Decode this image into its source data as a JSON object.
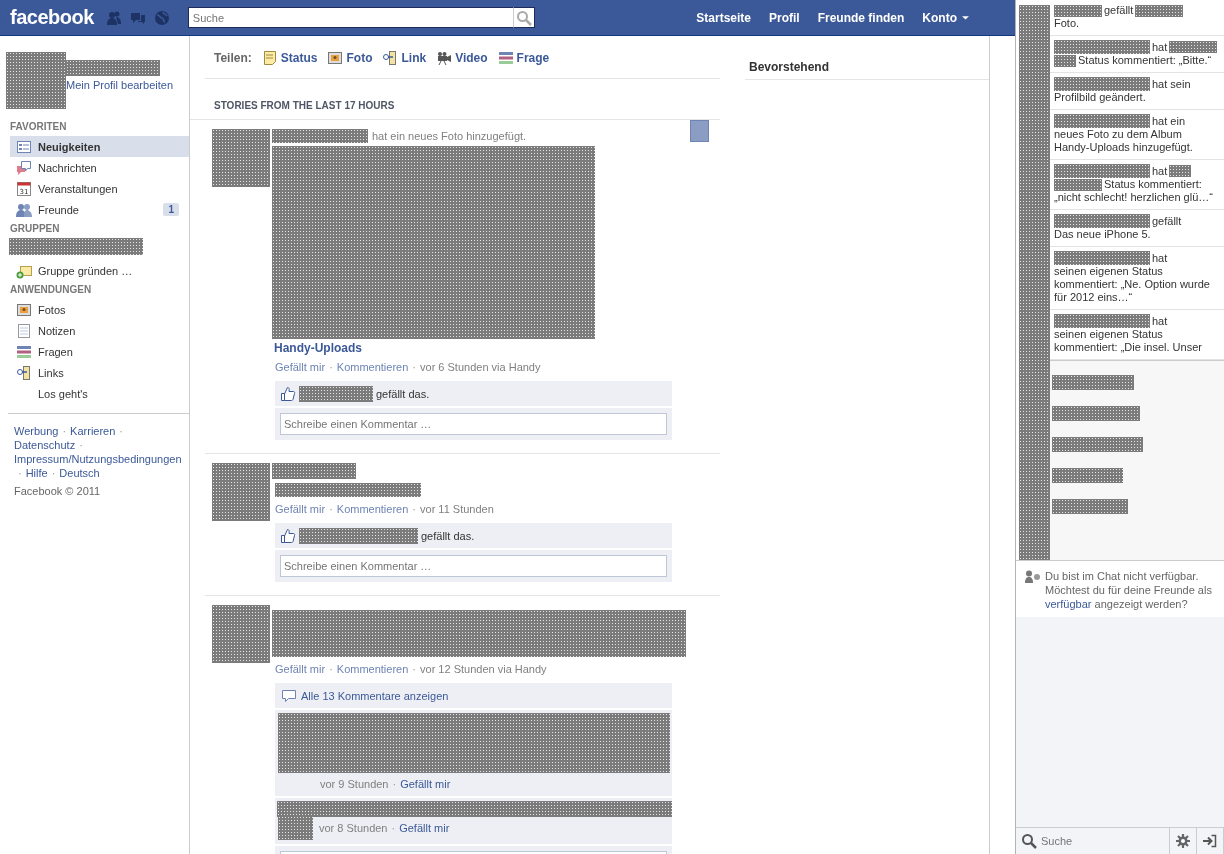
{
  "top_bar": {
    "logo": "facebook",
    "search": {
      "placeholder": "Suche"
    },
    "nav": [
      {
        "label": "Startseite",
        "menu": false
      },
      {
        "label": "Profil",
        "menu": false
      },
      {
        "label": "Freunde finden",
        "menu": false
      },
      {
        "label": "Konto",
        "menu": true
      }
    ]
  },
  "separator": "·",
  "sidebar": {
    "profile_link": "Mein Profil bearbeiten",
    "sections": [
      {
        "heading": "FAVORITEN",
        "items": [
          {
            "kind": "link",
            "label": "Neuigkeiten",
            "selected": true
          },
          {
            "kind": "link",
            "label": "Nachrichten",
            "selected": false
          },
          {
            "kind": "link",
            "icon_text": "31",
            "label": "Veranstaltungen",
            "selected": false
          },
          {
            "kind": "link",
            "label": "Freunde",
            "badge": "1",
            "selected": false
          }
        ]
      },
      {
        "heading": "GRUPPEN",
        "items": [
          {
            "kind": "redacted"
          },
          {
            "kind": "link",
            "label": "Gruppe gründen …",
            "selected": false
          }
        ]
      },
      {
        "heading": "ANWENDUNGEN",
        "items": [
          {
            "kind": "link",
            "label": "Fotos",
            "selected": false
          },
          {
            "kind": "link",
            "label": "Notizen",
            "selected": false
          },
          {
            "kind": "link",
            "label": "Fragen",
            "selected": false
          },
          {
            "kind": "link",
            "label": "Links",
            "selected": false
          },
          {
            "kind": "link",
            "label": "Los geht's",
            "selected": false
          }
        ]
      }
    ],
    "footer_links": [
      "Werbung",
      "Karrieren",
      "Datenschutz",
      "Impressum/Nutzungsbedingungen",
      "Hilfe",
      "Deutsch"
    ],
    "copyright": "Facebook © 2011"
  },
  "share_bar": {
    "label": "Teilen:",
    "options": [
      {
        "label": "Status"
      },
      {
        "label": "Foto"
      },
      {
        "label": "Link"
      },
      {
        "label": "Video"
      },
      {
        "label": "Frage"
      }
    ]
  },
  "feed": {
    "heading": "STORIES FROM THE LAST 17 HOURS",
    "posts": [
      {
        "kind": "photo",
        "caption": "hat ein neues Foto hinzugefügt.",
        "album": "Handy-Uploads",
        "options_button": true,
        "actions": [
          "Gefällt mir",
          "Kommentieren"
        ],
        "time": "vor 6 Stunden via Handy",
        "likes": "gefällt das.",
        "comment_field": true,
        "comment_placeholder": "Schreibe einen Kommentar …"
      },
      {
        "kind": "status",
        "options_button": false,
        "actions": [
          "Gefällt mir",
          "Kommentieren"
        ],
        "time": "vor 11 Stunden",
        "likes": "gefällt das.",
        "comment_field": true,
        "comment_placeholder": "Schreibe einen Kommentar …"
      },
      {
        "kind": "long_status",
        "options_button": false,
        "actions": [
          "Gefällt mir",
          "Kommentieren"
        ],
        "time": "vor 12 Stunden via Handy",
        "show_all": "Alle 13 Kommentare anzeigen",
        "comments": [
          {
            "kind": "block",
            "time": "vor 9 Stunden",
            "like": "Gefällt mir"
          },
          {
            "kind": "with_avatar",
            "time": "vor 8 Stunden",
            "like": "Gefällt mir"
          }
        ],
        "comment_field": true
      }
    ]
  },
  "upcoming": {
    "title": "Bevorstehend"
  },
  "ticker": [
    {
      "lines": [
        [
          {
            "kind": "redacted"
          },
          {
            "kind": "text",
            "text": "gefällt"
          },
          {
            "kind": "redacted"
          }
        ],
        [
          {
            "kind": "text",
            "text": "Foto."
          }
        ]
      ]
    },
    {
      "lines": [
        [
          {
            "kind": "redacted_long"
          },
          {
            "kind": "text",
            "text": "hat"
          },
          {
            "kind": "redacted"
          }
        ],
        [
          {
            "kind": "redacted_short"
          },
          {
            "kind": "text",
            "text": "Status kommentiert: „Bitte.“"
          }
        ]
      ]
    },
    {
      "lines": [
        [
          {
            "kind": "redacted_long"
          },
          {
            "kind": "text",
            "text": "hat sein"
          }
        ],
        [
          {
            "kind": "text",
            "text": "Profilbild geändert."
          }
        ]
      ]
    },
    {
      "lines": [
        [
          {
            "kind": "redacted_long"
          },
          {
            "kind": "text",
            "text": "hat ein"
          }
        ],
        [
          {
            "kind": "text",
            "text": "neues Foto zu dem Album"
          }
        ],
        [
          {
            "kind": "text",
            "text": "Handy-Uploads hinzugefügt."
          }
        ]
      ]
    },
    {
      "lines": [
        [
          {
            "kind": "redacted_long"
          },
          {
            "kind": "text",
            "text": "hat"
          },
          {
            "kind": "redacted_short"
          }
        ],
        [
          {
            "kind": "redacted"
          },
          {
            "kind": "text",
            "text": "Status kommentiert:"
          }
        ],
        [
          {
            "kind": "text",
            "text": "„nicht schlecht! herzlichen glü…“"
          }
        ]
      ]
    },
    {
      "lines": [
        [
          {
            "kind": "redacted_long"
          },
          {
            "kind": "text",
            "text": "gefällt"
          }
        ],
        [
          {
            "kind": "text",
            "text": "Das neue iPhone 5."
          }
        ]
      ]
    },
    {
      "lines": [
        [
          {
            "kind": "redacted_long"
          },
          {
            "kind": "text",
            "text": "hat"
          }
        ],
        [
          {
            "kind": "text",
            "text": "seinen eigenen Status"
          }
        ],
        [
          {
            "kind": "text",
            "text": "kommentiert: „Ne. Option wurde"
          }
        ],
        [
          {
            "kind": "text",
            "text": "für 2012 eins…“"
          }
        ]
      ]
    },
    {
      "lines": [
        [
          {
            "kind": "redacted_long"
          },
          {
            "kind": "text",
            "text": "hat"
          }
        ],
        [
          {
            "kind": "text",
            "text": "seinen eigenen Status"
          }
        ],
        [
          {
            "kind": "text",
            "text": "kommentiert: „Die insel. Unser"
          }
        ]
      ]
    }
  ],
  "chat": {
    "notice_before": "Du bist im Chat nicht verfügbar. Möchtest du für deine Freunde als ",
    "notice_link": "verfügbar",
    "notice_after": " angezeigt werden?",
    "search": {
      "placeholder": "Suche"
    }
  }
}
